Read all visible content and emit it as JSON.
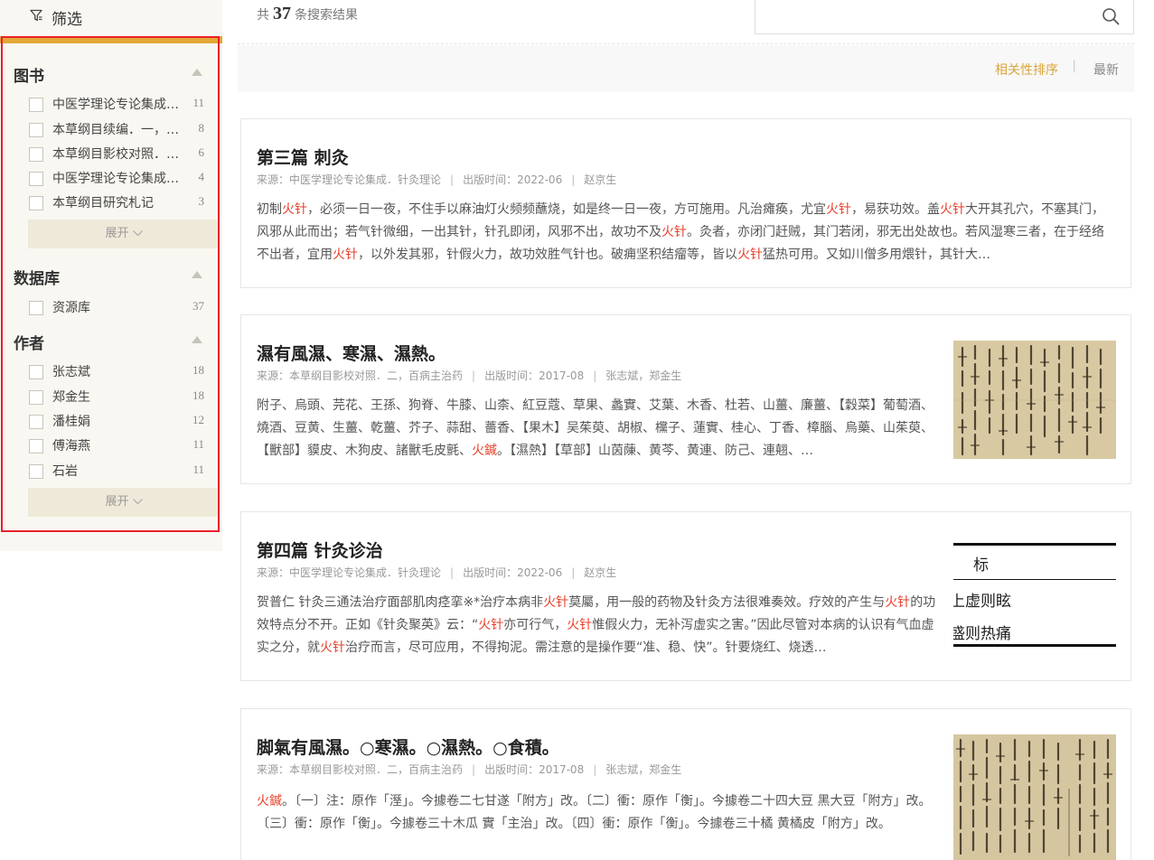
{
  "sidebar": {
    "filter_label": "筛选",
    "expand_label": "展开",
    "sections": [
      {
        "title": "图书",
        "items": [
          {
            "label": "中医学理论专论集成．针灸理论",
            "count": "11"
          },
          {
            "label": "本草纲目续编．一，诸病主治药",
            "count": "8"
          },
          {
            "label": "本草纲目影校对照．二，百病主治药",
            "count": "6"
          },
          {
            "label": "中医学理论专论集成．临证治疗",
            "count": "4"
          },
          {
            "label": "本草纲目研究札记",
            "count": "3"
          }
        ]
      },
      {
        "title": "数据库",
        "items": [
          {
            "label": "资源库",
            "count": "37"
          }
        ]
      },
      {
        "title": "作者",
        "items": [
          {
            "label": "张志斌",
            "count": "18"
          },
          {
            "label": "郑金生",
            "count": "18"
          },
          {
            "label": "潘桂娟",
            "count": "12"
          },
          {
            "label": "傅海燕",
            "count": "11"
          },
          {
            "label": "石岩",
            "count": "11"
          }
        ]
      }
    ]
  },
  "topbar": {
    "count_prefix": "共",
    "count": "37",
    "count_suffix": "条搜索结果",
    "search_value": "",
    "search_placeholder": ""
  },
  "sort": {
    "relevance": "相关性排序",
    "separator": "|",
    "newest": "最新"
  },
  "results": [
    {
      "title": "第三篇 刺灸",
      "source": "来源：中医学理论专论集成．针灸理论",
      "date": "出版时间：2022-06",
      "author": "赵京生",
      "snippet": [
        {
          "t": "初制"
        },
        {
          "t": "火针",
          "hl": true
        },
        {
          "t": "，必须一日一夜，不住手以麻油灯火频频蘸烧，如是终一日一夜，方可施用。凡治瘫痪，尤宜"
        },
        {
          "t": "火针",
          "hl": true
        },
        {
          "t": "，易获功效。盖"
        },
        {
          "t": "火针",
          "hl": true
        },
        {
          "t": "大开其孔穴，不塞其门，风邪从此而出；若气针微细，一出其针，针孔即闭，风邪不出，故功不及"
        },
        {
          "t": "火针",
          "hl": true
        },
        {
          "t": "。灸者，亦闭门赶贼，其门若闭，邪无出处故也。若风湿寒三者，在于经络不出者，宜用"
        },
        {
          "t": "火针",
          "hl": true
        },
        {
          "t": "，以外发其邪，针假火力，故功效胜气针也。破痈坚积结瘤等，皆以"
        },
        {
          "t": "火针",
          "hl": true
        },
        {
          "t": "猛热可用。又如川僧多用煨针，其针大…"
        }
      ],
      "thumb": ""
    },
    {
      "title": "濕有風濕、寒濕、濕熱。",
      "source": "来源：本草纲目影校对照．二，百病主治药",
      "date": "出版时间：2017-08",
      "author": "张志斌，郑金生",
      "snippet": [
        {
          "t": "附子、烏頭、芫花、王孫、狗脊、牛膝、山柰、紅豆蔻、草果、蠡實、艾葉、木香、杜若、山薑、廉薑、【穀菜】葡萄酒、燒酒、豆黄、生薑、乾薑、芥子、蒜甜、薔香、【果木】吴茱萸、胡椒、欓子、蓮實、桂心、丁香、樟腦、烏藥、山茱萸、【獸部】貘皮、木狗皮、諸獸毛皮氈、"
        },
        {
          "t": "火鍼",
          "hl": true
        },
        {
          "t": "。【濕熱】【草部】山茵蔯、黄芩、黄連、防己、連翹、…"
        }
      ],
      "thumb": "old-book-page"
    },
    {
      "title": "第四篇 针灸诊治",
      "source": "来源：中医学理论专论集成．针灸理论",
      "date": "出版时间：2022-06",
      "author": "赵京生",
      "snippet": [
        {
          "t": "贺普仁 针灸三通法治疗面部肌肉痉挛※*治疗本病非"
        },
        {
          "t": "火针",
          "hl": true
        },
        {
          "t": "莫屬，用一般的药物及针灸方法很难奏效。疗效的产生与"
        },
        {
          "t": "火针",
          "hl": true
        },
        {
          "t": "的功效特点分不开。正如《针灸聚英》云：“"
        },
        {
          "t": "火针",
          "hl": true
        },
        {
          "t": "亦可行气，"
        },
        {
          "t": "火针",
          "hl": true
        },
        {
          "t": "惟假火力，无补泻虚实之害。”因此尽管对本病的认识有气血虚实之分，就"
        },
        {
          "t": "火针",
          "hl": true
        },
        {
          "t": "治疗而言，尽可应用，不得拘泥。需注意的是操作要“准、稳、快”。针要烧红、烧透…"
        }
      ],
      "thumb": "table",
      "thumb_table": [
        "标",
        "上虚则眩",
        "盛则热痛"
      ]
    },
    {
      "title": "脚氣有風濕。○寒濕。○濕熱。○食積。",
      "source": "来源：本草纲目影校对照．二，百病主治药",
      "date": "出版时间：2017-08",
      "author": "张志斌，郑金生",
      "snippet": [
        {
          "t": "火鍼",
          "hl": true
        },
        {
          "t": "。〔一〕注：原作「溼」。今據卷二七甘遂「附方」改。〔二〕衝：原作「衡」。今據卷二十四大豆 黑大豆「附方」改。〔三〕衝：原作「衡」。今據卷三十木瓜 實「主治」改。〔四〕衝：原作「衡」。今據卷三十橘 黄橘皮「附方」改。"
        }
      ],
      "thumb": "old-book-page"
    }
  ]
}
